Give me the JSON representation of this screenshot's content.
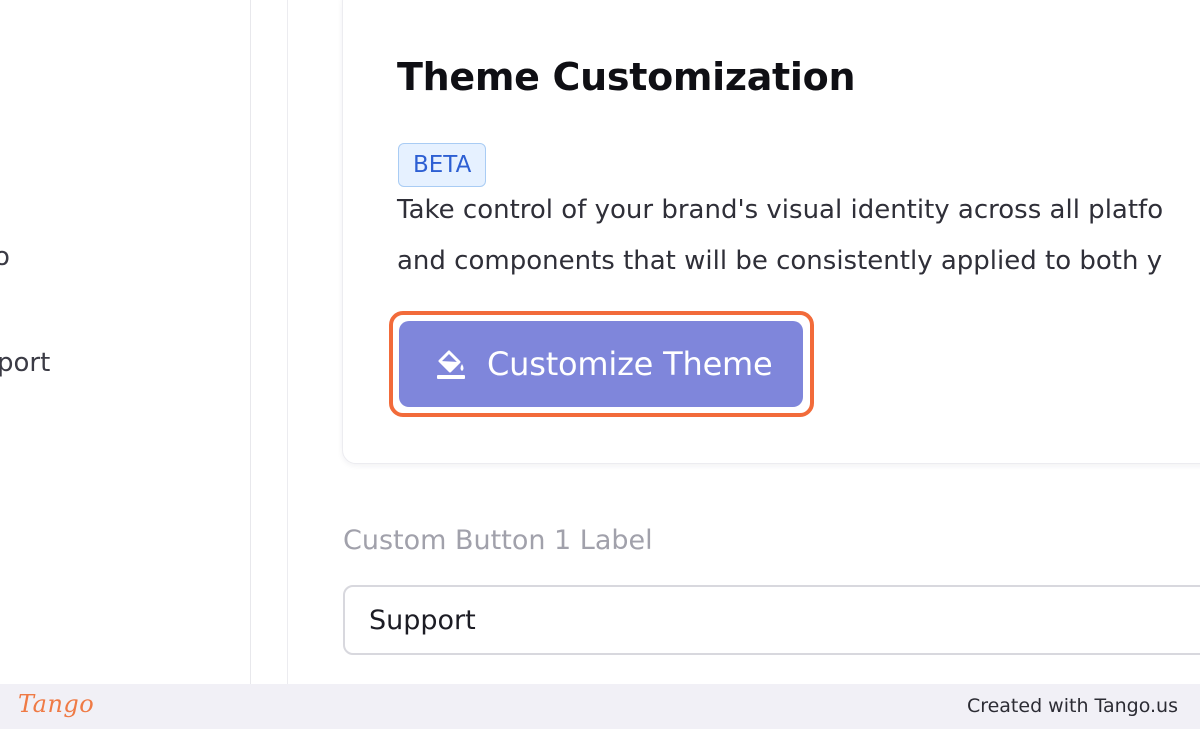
{
  "sidebar": {
    "items": [
      {
        "label": "o"
      },
      {
        "label": "port"
      }
    ]
  },
  "card": {
    "title": "Theme Customization",
    "badge": "BETA",
    "description_lines": [
      "Take control of your brand's visual identity across all platfo",
      "and components that will be consistently applied to both y"
    ],
    "button": {
      "label": "Customize Theme",
      "icon": "paint-bucket-icon"
    }
  },
  "custom_button_1": {
    "label": "Custom Button 1 Label",
    "value": "Support"
  },
  "footer": {
    "logo": "Tango",
    "credit": "Created with Tango.us"
  },
  "colors": {
    "button": "#7f86db",
    "highlight": "#f26b3a",
    "badge_text": "#2d5fd3",
    "badge_bg": "#e6f1ff",
    "footer_bg": "#f1f0f6",
    "logo": "#ef7a45"
  }
}
